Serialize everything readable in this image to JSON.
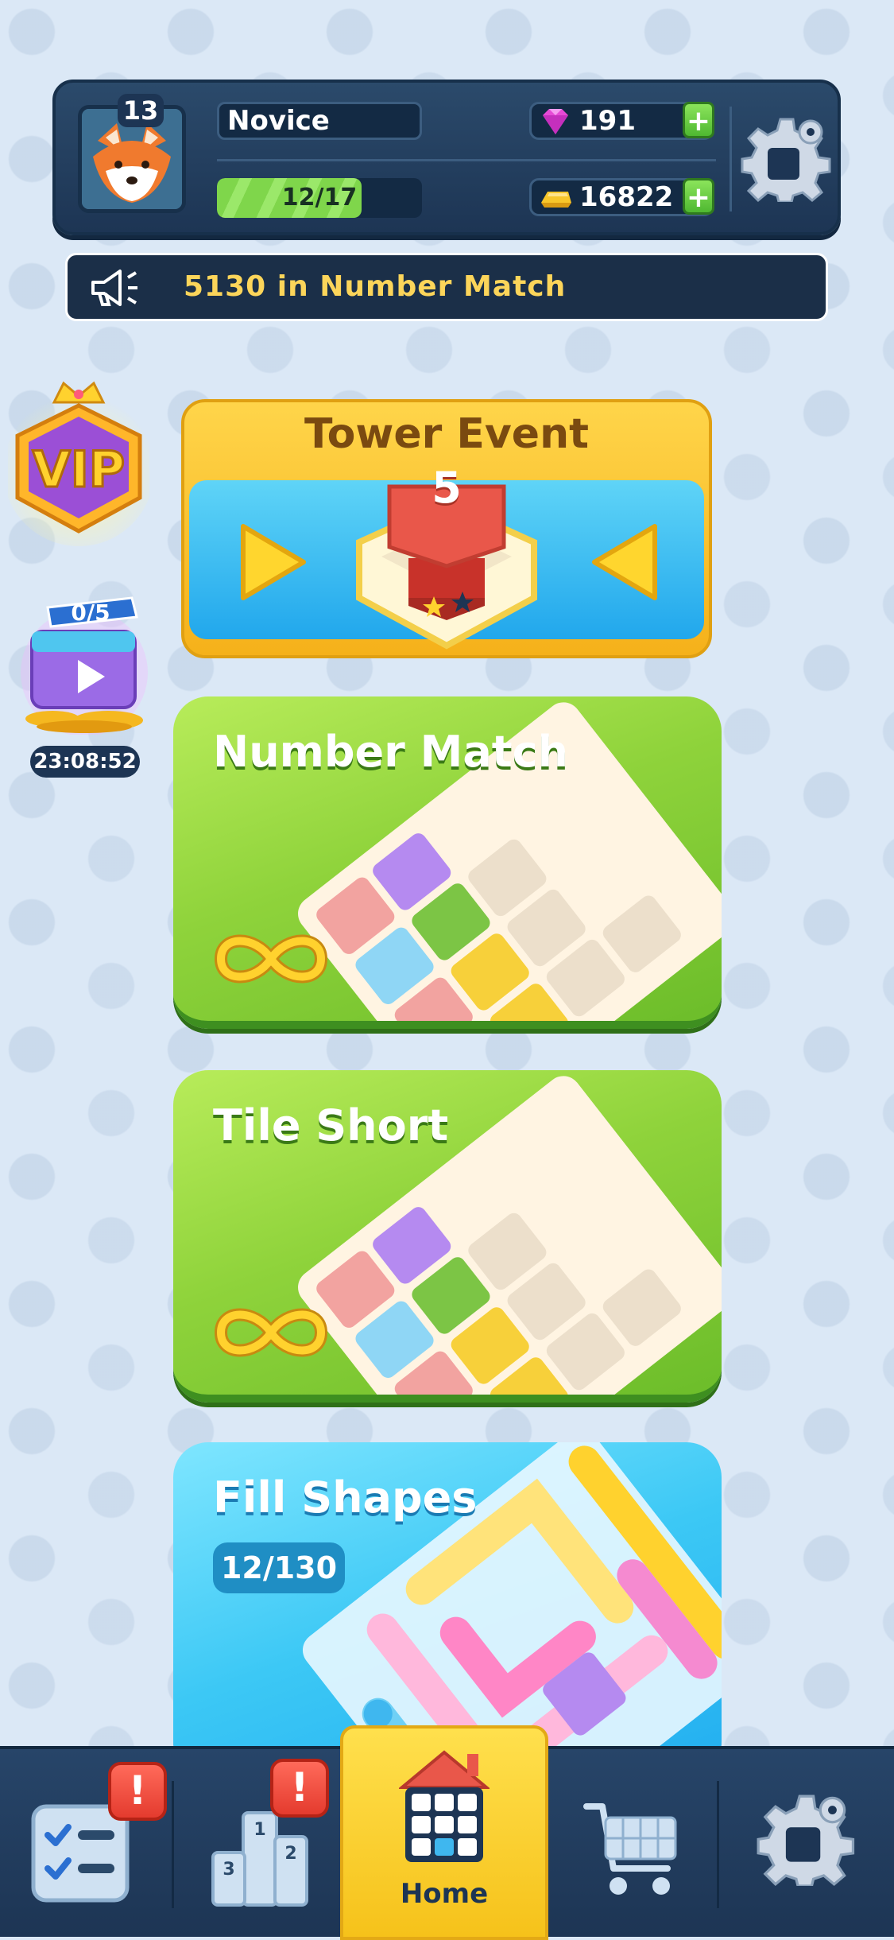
{
  "header": {
    "level": "13",
    "player_name": "Novice",
    "xp_text": "12/17",
    "xp_fraction": 0.7059,
    "gems": "191",
    "coins": "16822",
    "plus": "+"
  },
  "ticker": {
    "text": "5130 in Number Match"
  },
  "side": {
    "video_counter": "0/5",
    "timer": "23:08:52",
    "vip_label": "VIP"
  },
  "tower_event": {
    "title": "Tower Event",
    "level": "5"
  },
  "cards": {
    "number_match": {
      "title": "Number Match"
    },
    "tile_short": {
      "title": "Tile Short"
    },
    "fill_shapes": {
      "title": "Fill Shapes",
      "progress": "12/130"
    }
  },
  "nav": {
    "home_label": "Home",
    "badge_mark": "!",
    "items": [
      "tasks",
      "leaderboard",
      "home",
      "shop",
      "settings"
    ]
  },
  "colors": {
    "accent_yellow": "#f6c21a",
    "navy": "#1d3554",
    "green_card": "#8fd33b",
    "blue_card": "#3cc8f5",
    "badge_red": "#e43b2e"
  }
}
